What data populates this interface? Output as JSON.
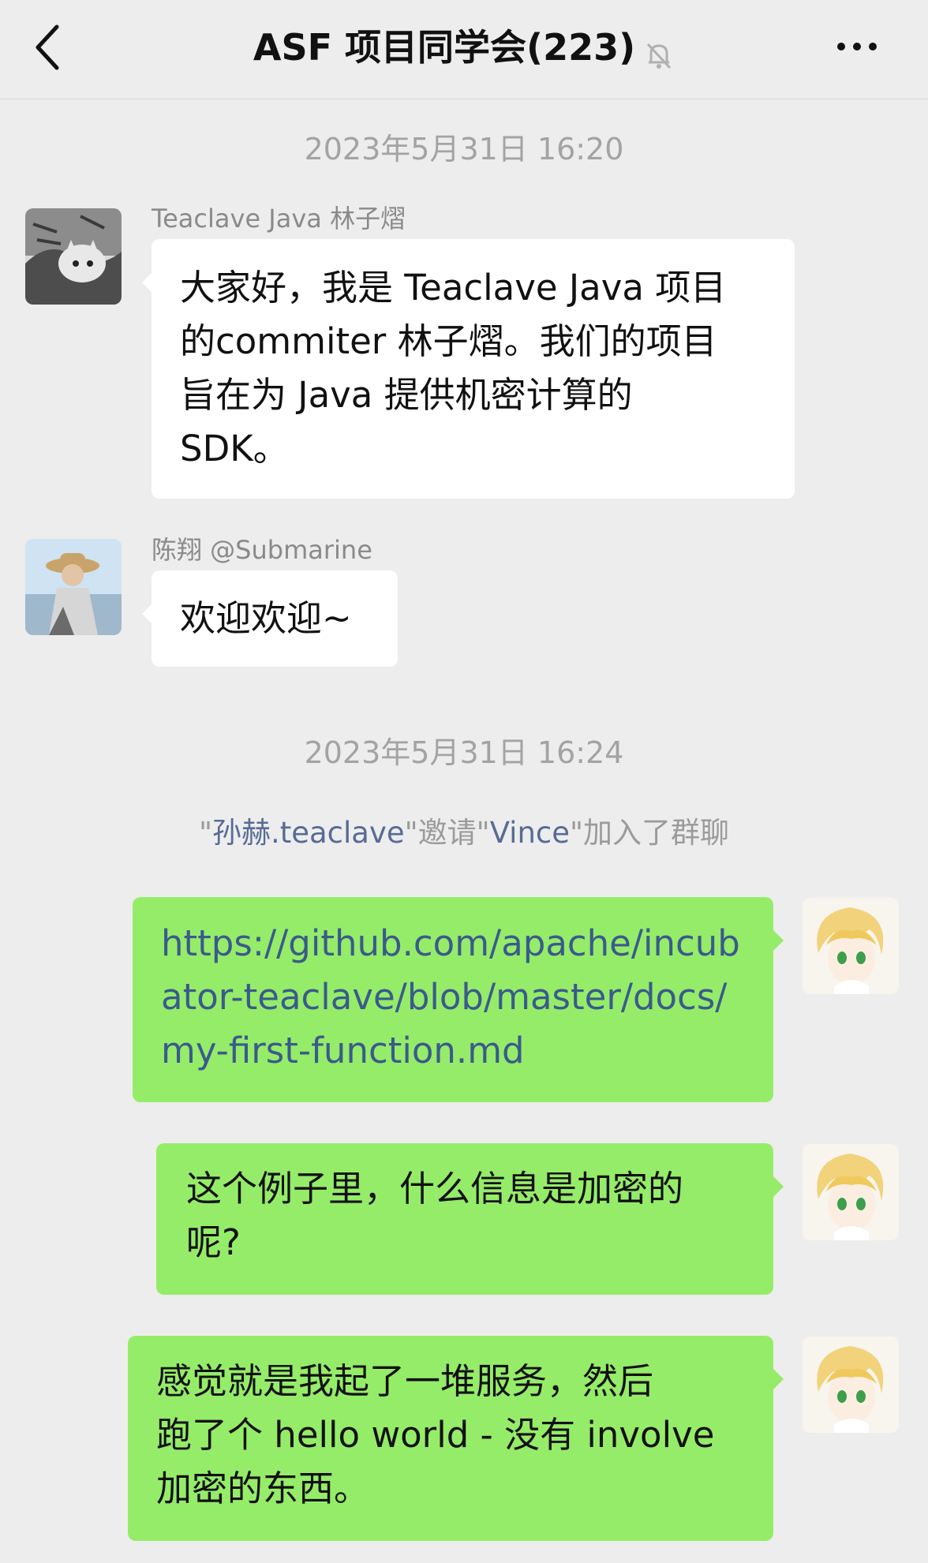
{
  "header": {
    "title": "ASF 项目同学会(223)",
    "back_icon": "chevron-left-icon",
    "mute_icon": "bell-off-icon",
    "more_icon": "more-dots-icon"
  },
  "timestamps": [
    "2023年5月31日 16:20",
    "2023年5月31日 16:24"
  ],
  "messages": [
    {
      "sender": "Teaclave Java 林子熠",
      "text": "大家好，我是 Teaclave Java 项目\n的commiter 林子熠。我们的项目\n旨在为 Java 提供机密计算的\nSDK。"
    },
    {
      "sender": "陈翔 @Submarine",
      "text": "欢迎欢迎~"
    },
    {
      "text": "https://github.com/apache/incub\nator-teaclave/blob/master/docs/\nmy-first-function.md"
    },
    {
      "text": "这个例子里，什么信息是加密的\n呢?"
    },
    {
      "text": "感觉就是我起了一堆服务，然后\n跑了个 hello world - 没有 involve\n加密的东西。"
    }
  ],
  "system_notice": {
    "q1": "\"",
    "inviter": "孙赫.teaclave",
    "mid": "\"邀请\"",
    "invitee": "Vince",
    "tail": "\"加入了群聊"
  },
  "colors": {
    "background": "#ededed",
    "self_bubble": "#95ec69",
    "other_bubble": "#ffffff",
    "link_text": "#576b95"
  }
}
